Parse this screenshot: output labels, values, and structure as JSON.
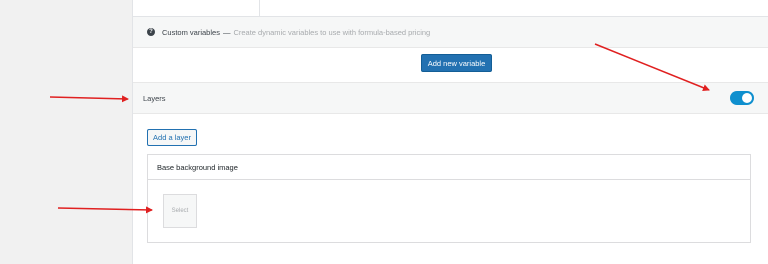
{
  "custom_variables": {
    "title": "Custom variables",
    "separator": "—",
    "description": "Create dynamic variables to use with formula-based pricing",
    "add_button_label": "Add new variable",
    "help_icon_glyph": "?"
  },
  "layers": {
    "label": "Layers",
    "toggle_enabled": true,
    "add_layer_label": "Add a layer",
    "base_image_label": "Base background image",
    "select_label": "Select"
  },
  "colors": {
    "primary_button": "#2271b1",
    "toggle_on": "#0f8fce",
    "annotation_arrow": "#e02020"
  },
  "icons": {
    "help": "help-icon",
    "annotation": "arrow-annotation-icon"
  }
}
